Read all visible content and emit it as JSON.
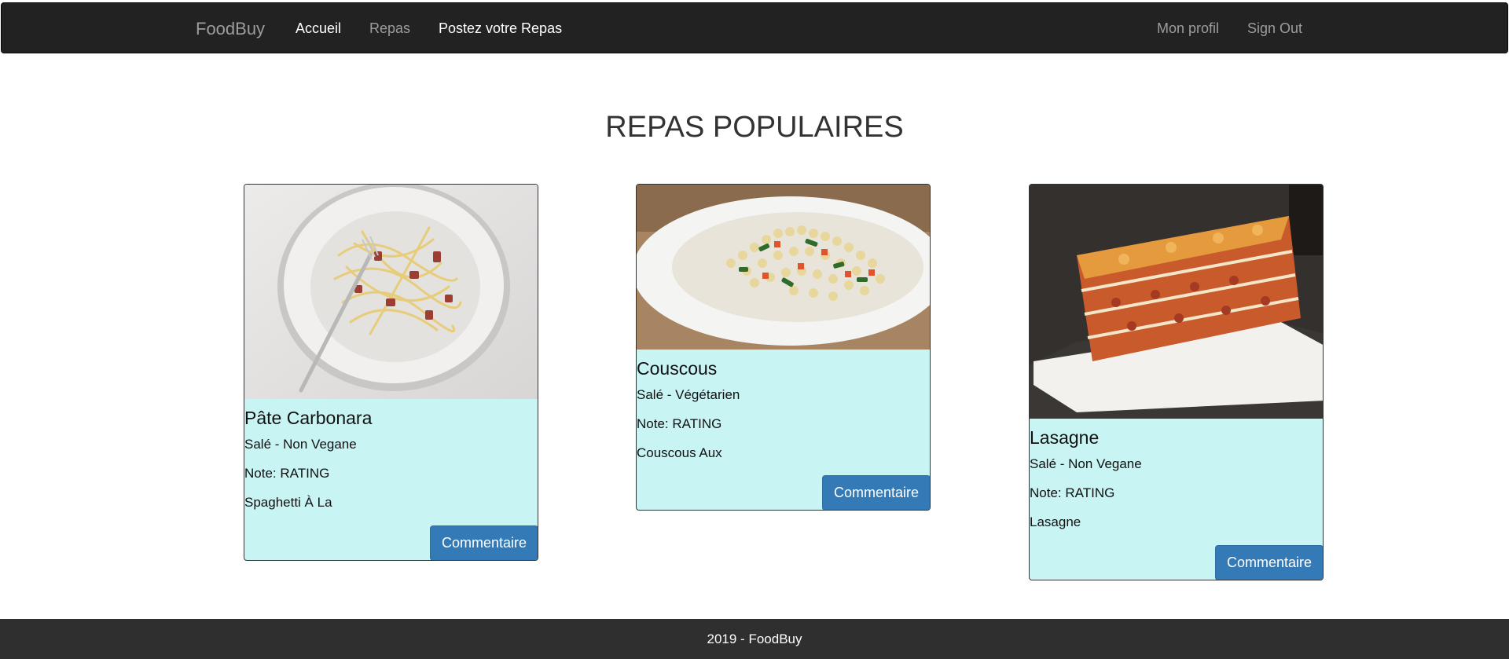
{
  "nav": {
    "brand": "FoodBuy",
    "links": [
      {
        "label": "Accueil"
      },
      {
        "label": "Repas"
      },
      {
        "label": "Postez votre Repas"
      }
    ],
    "right_links": [
      {
        "label": "Mon profil"
      },
      {
        "label": "Sign Out"
      }
    ]
  },
  "main": {
    "title": "REPAS POPULAIRES",
    "cards": [
      {
        "image_alt": "Pâte Carbonara",
        "name": "Pâte Carbonara",
        "category": "Salé - Non Vegane",
        "rating": "Note: RATING",
        "description": "Spaghetti À La",
        "button": "Commentaire"
      },
      {
        "image_alt": "Couscous",
        "name": "Couscous",
        "category": "Salé - Végétarien",
        "rating": "Note: RATING",
        "description": "Couscous Aux",
        "button": "Commentaire"
      },
      {
        "image_alt": "Lasagne",
        "name": "Lasagne",
        "category": "Salé - Non Vegane",
        "rating": "Note: RATING",
        "description": "Lasagne",
        "button": "Commentaire"
      }
    ]
  },
  "footer": {
    "text": "2019 - FoodBuy"
  },
  "colors": {
    "navbar": "#222222",
    "card_background": "#c9f4f4",
    "button": "#337ab7",
    "footer": "#2f2f2f"
  }
}
